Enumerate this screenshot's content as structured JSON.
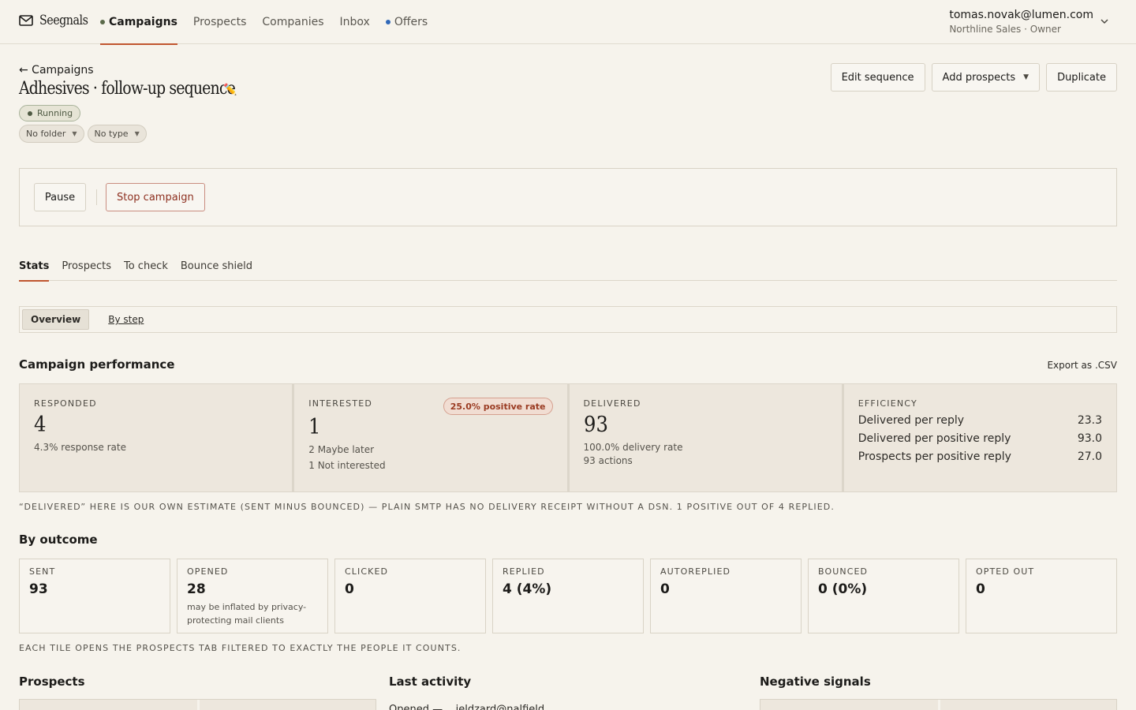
{
  "brand": {
    "name": "Seegnals",
    "icon": "mail-icon"
  },
  "nav": {
    "items": [
      {
        "label": "Campaigns",
        "active": true,
        "dot": "green"
      },
      {
        "label": "Prospects"
      },
      {
        "label": "Companies"
      },
      {
        "label": "Inbox"
      },
      {
        "label": "Offers",
        "dot": "blue"
      }
    ]
  },
  "account": {
    "email": "tomas.novak@lumen.com",
    "org": "Northline Sales · Owner",
    "icon": "chevron-down-icon"
  },
  "header": {
    "back_label": "← Campaigns",
    "title": "Adhesives · follow-up sequence",
    "edit_icon": "✏️",
    "status": "Running",
    "folder": "No folder",
    "type": "No type",
    "actions": {
      "edit_sequence": "Edit sequence",
      "add_prospects": "Add prospects",
      "duplicate": "Duplicate"
    }
  },
  "controls": {
    "pause": "Pause",
    "stop": "Stop campaign"
  },
  "tabs": [
    {
      "label": "Stats",
      "active": true
    },
    {
      "label": "Prospects"
    },
    {
      "label": "To check"
    },
    {
      "label": "Bounce shield"
    }
  ],
  "subtabs": [
    {
      "label": "Overview",
      "active": true
    },
    {
      "label": "By step"
    }
  ],
  "performance": {
    "title": "Campaign performance",
    "export_label": "Export as .CSV",
    "responded": {
      "label": "Responded",
      "value": "4",
      "sub": "4.3% response rate"
    },
    "interested": {
      "label": "Interested",
      "value": "1",
      "badge": "25.0% positive rate",
      "sub1": "2 Maybe later",
      "sub2": "1 Not interested"
    },
    "delivered": {
      "label": "Delivered",
      "value": "93",
      "sub1": "100.0% delivery rate",
      "sub2": "93 actions"
    },
    "efficiency": {
      "label": "Efficiency",
      "rows": [
        {
          "label": "Delivered per reply",
          "value": "23.3"
        },
        {
          "label": "Delivered per positive reply",
          "value": "93.0"
        },
        {
          "label": "Prospects per positive reply",
          "value": "27.0"
        }
      ]
    },
    "footnote": "“Delivered” here is our own estimate (sent minus bounced) — plain SMTP has no delivery receipt without a DSN. 1 positive out of 4 replied."
  },
  "outcome": {
    "title": "By outcome",
    "tiles": [
      {
        "label": "Sent",
        "value": "93",
        "note": ""
      },
      {
        "label": "Opened",
        "value": "28",
        "note": "may be inflated by privacy-protecting mail clients"
      },
      {
        "label": "Clicked",
        "value": "0",
        "note": ""
      },
      {
        "label": "Replied",
        "value": "4 (4%)",
        "note": ""
      },
      {
        "label": "Autoreplied",
        "value": "0",
        "note": ""
      },
      {
        "label": "Bounced",
        "value": "0 (0%)",
        "note": ""
      },
      {
        "label": "Opted out",
        "value": "0",
        "note": ""
      }
    ],
    "footnote": "Each tile opens the Prospects tab filtered to exactly the people it counts."
  },
  "bottom": {
    "prospects_title": "Prospects",
    "last_activity_title": "Last activity",
    "last_activity_first_row": "Opened — ...jeldzard@nalfield...",
    "negative_title": "Negative signals"
  }
}
